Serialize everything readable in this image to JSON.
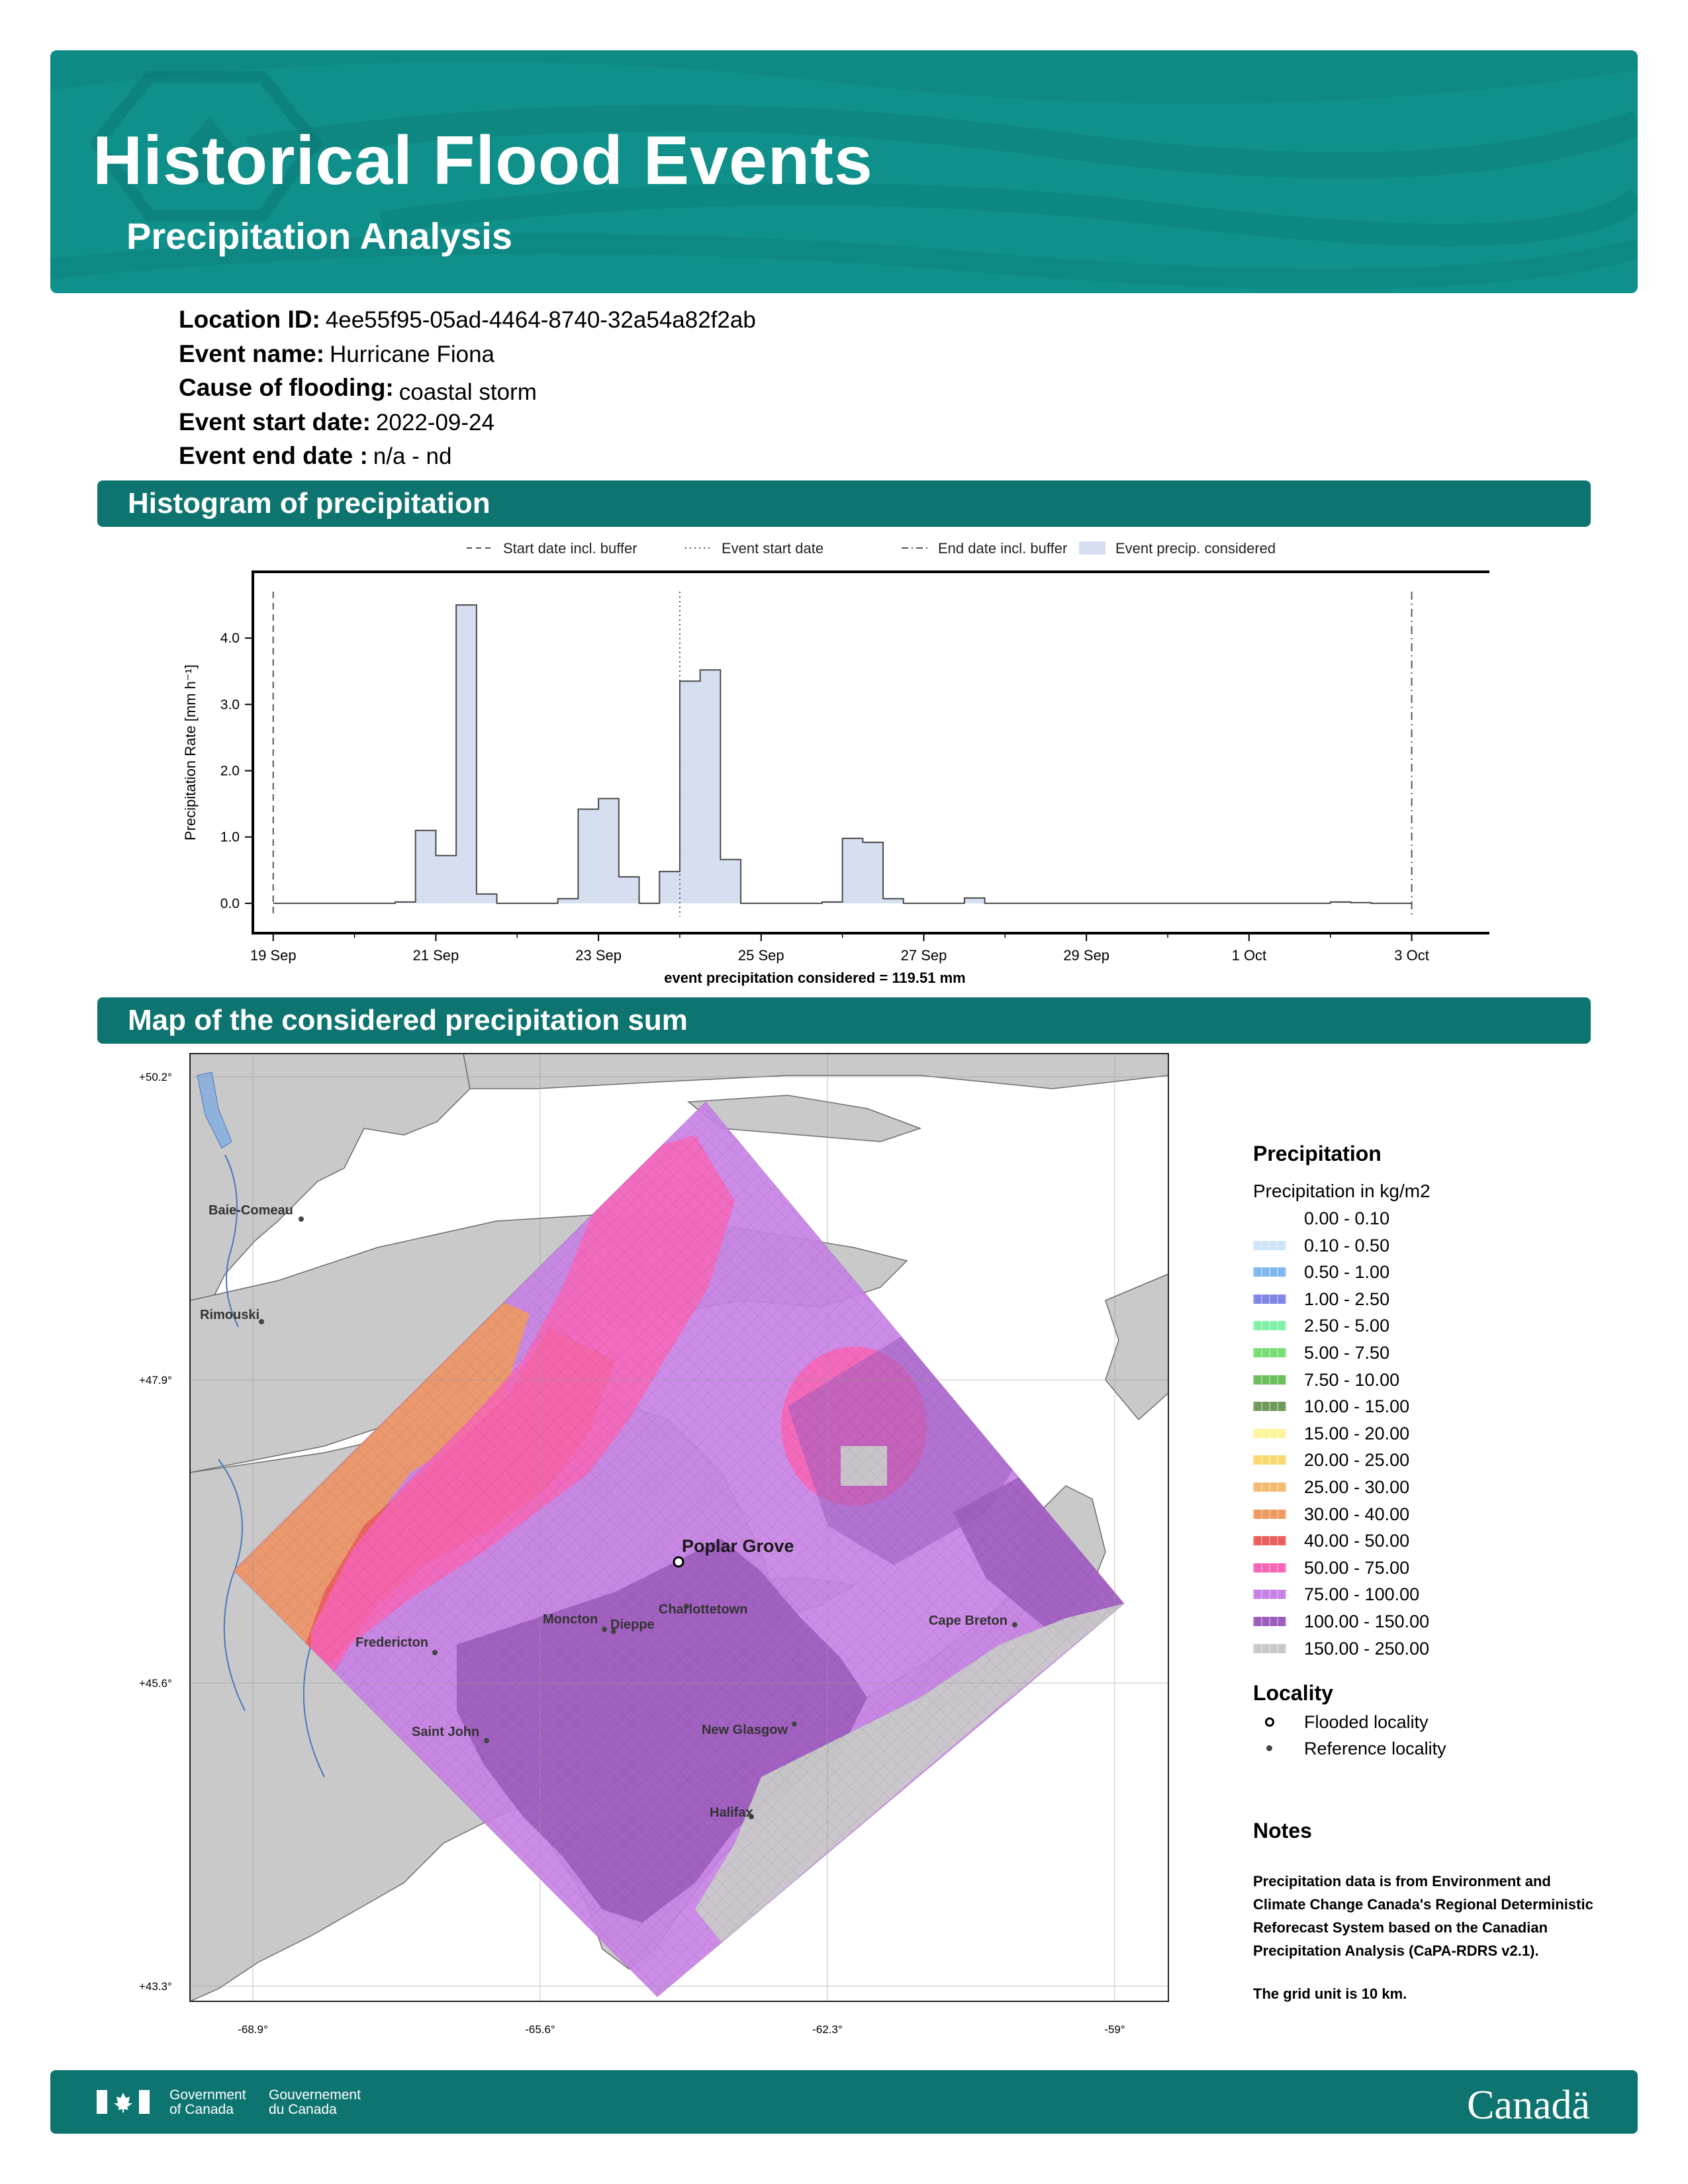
{
  "header": {
    "title": "Historical Flood Events",
    "subtitle": "Precipitation Analysis"
  },
  "info": {
    "location_id_label": "Location ID:",
    "location_id": "4ee55f95-05ad-4464-8740-32a54a82f2ab",
    "event_name_label": "Event name:",
    "event_name": "Hurricane Fiona",
    "cause_label": "Cause of flooding:",
    "cause": "coastal storm",
    "start_label": "Event start date:",
    "start": "2022-09-24",
    "end_label": "Event end date :",
    "end": "n/a - nd"
  },
  "sections": {
    "histogram": "Histogram of precipitation",
    "map": "Map of the considered precipitation sum"
  },
  "chart_data": {
    "type": "bar",
    "ylabel": "Precipitation Rate [mm h⁻¹]",
    "xlabel": "event precipitation considered = 119.51 mm",
    "ylim": [
      -0.45,
      5.0
    ],
    "yticks": [
      "0.0",
      "1.0",
      "2.0",
      "3.0",
      "4.0"
    ],
    "xlim_days": [
      18.75,
      34.2
    ],
    "xticks": [
      {
        "label": "19 Sep",
        "day": 19
      },
      {
        "label": "21 Sep",
        "day": 21
      },
      {
        "label": "23 Sep",
        "day": 23
      },
      {
        "label": "25 Sep",
        "day": 25
      },
      {
        "label": "27 Sep",
        "day": 27
      },
      {
        "label": "29 Sep",
        "day": 29
      },
      {
        "label": "1 Oct",
        "day": 31
      },
      {
        "label": "3 Oct",
        "day": 33
      }
    ],
    "bar_width_days": 0.25,
    "bars": [
      {
        "day": 19.0,
        "value": 0.0
      },
      {
        "day": 19.25,
        "value": 0.0
      },
      {
        "day": 19.5,
        "value": 0.0
      },
      {
        "day": 19.75,
        "value": 0.0
      },
      {
        "day": 20.0,
        "value": 0.0
      },
      {
        "day": 20.25,
        "value": 0.0
      },
      {
        "day": 20.5,
        "value": 0.02
      },
      {
        "day": 20.75,
        "value": 1.1
      },
      {
        "day": 21.0,
        "value": 0.72
      },
      {
        "day": 21.25,
        "value": 4.5
      },
      {
        "day": 21.5,
        "value": 0.14
      },
      {
        "day": 21.75,
        "value": 0.0
      },
      {
        "day": 22.0,
        "value": 0.0
      },
      {
        "day": 22.25,
        "value": 0.0
      },
      {
        "day": 22.5,
        "value": 0.07
      },
      {
        "day": 22.75,
        "value": 1.42
      },
      {
        "day": 23.0,
        "value": 1.58
      },
      {
        "day": 23.25,
        "value": 0.4
      },
      {
        "day": 23.5,
        "value": 0.0
      },
      {
        "day": 23.75,
        "value": 0.48
      },
      {
        "day": 24.0,
        "value": 3.35
      },
      {
        "day": 24.25,
        "value": 3.52
      },
      {
        "day": 24.5,
        "value": 0.66
      },
      {
        "day": 24.75,
        "value": 0.0
      },
      {
        "day": 25.0,
        "value": 0.0
      },
      {
        "day": 25.25,
        "value": 0.0
      },
      {
        "day": 25.5,
        "value": 0.0
      },
      {
        "day": 25.75,
        "value": 0.02
      },
      {
        "day": 26.0,
        "value": 0.98
      },
      {
        "day": 26.25,
        "value": 0.92
      },
      {
        "day": 26.5,
        "value": 0.07
      },
      {
        "day": 26.75,
        "value": 0.0
      },
      {
        "day": 27.0,
        "value": 0.0
      },
      {
        "day": 27.25,
        "value": 0.0
      },
      {
        "day": 27.5,
        "value": 0.08
      },
      {
        "day": 27.75,
        "value": 0.0
      },
      {
        "day": 28.0,
        "value": 0.0
      },
      {
        "day": 28.25,
        "value": 0.0
      },
      {
        "day": 28.5,
        "value": 0.0
      },
      {
        "day": 28.75,
        "value": 0.0
      },
      {
        "day": 29.0,
        "value": 0.0
      },
      {
        "day": 29.25,
        "value": 0.0
      },
      {
        "day": 29.5,
        "value": 0.0
      },
      {
        "day": 29.75,
        "value": 0.0
      },
      {
        "day": 30.0,
        "value": 0.0
      },
      {
        "day": 30.25,
        "value": 0.0
      },
      {
        "day": 30.5,
        "value": 0.0
      },
      {
        "day": 30.75,
        "value": 0.0
      },
      {
        "day": 31.0,
        "value": 0.0
      },
      {
        "day": 31.25,
        "value": 0.0
      },
      {
        "day": 31.5,
        "value": 0.0
      },
      {
        "day": 31.75,
        "value": 0.0
      },
      {
        "day": 32.0,
        "value": 0.02
      },
      {
        "day": 32.25,
        "value": 0.01
      },
      {
        "day": 32.5,
        "value": 0.0
      },
      {
        "day": 32.75,
        "value": 0.0
      }
    ],
    "vlines": [
      {
        "day": 19,
        "style": "dashed",
        "legend": "Start date incl. buffer"
      },
      {
        "day": 24,
        "style": "dotted",
        "legend": "Event start date"
      },
      {
        "day": 33,
        "style": "dashdot",
        "legend": "End date incl. buffer"
      }
    ],
    "fill_legend": "Event precip. considered",
    "bar_color": "#d5dff0",
    "bar_edge": "#4a4a4a"
  },
  "map": {
    "lat_labels": [
      "+50.2°",
      "+47.9°",
      "+45.6°",
      "+43.3°"
    ],
    "lon_labels": [
      "-68.9°",
      "-65.6°",
      "-62.3°",
      "-59°"
    ],
    "flooded_locality": "Poplar Grove",
    "reference_localities": [
      "Baie-Comeau",
      "Rimouski",
      "Fredericton",
      "Moncton",
      "Dieppe",
      "Charlottetown",
      "Saint John",
      "New Glasgow",
      "Halifax",
      "Cape Breton"
    ]
  },
  "legend": {
    "title": "Precipitation",
    "subtitle": "Precipitation in kg/m2",
    "classes": [
      {
        "label": "0.00 - 0.10",
        "color": "#ffffff"
      },
      {
        "label": "0.10 - 0.50",
        "color": "#cfe5f7"
      },
      {
        "label": "0.50 - 1.00",
        "color": "#7fb8ee"
      },
      {
        "label": "1.00 - 2.50",
        "color": "#7f86e6"
      },
      {
        "label": "2.50 - 5.00",
        "color": "#7ff0a6"
      },
      {
        "label": "5.00 - 7.50",
        "color": "#78dd72"
      },
      {
        "label": "7.50 - 10.00",
        "color": "#6cbd5c"
      },
      {
        "label": "10.00 - 15.00",
        "color": "#6f9a5d"
      },
      {
        "label": "15.00 - 20.00",
        "color": "#fdf59b"
      },
      {
        "label": "20.00 - 25.00",
        "color": "#f7d86f"
      },
      {
        "label": "25.00 - 30.00",
        "color": "#f2bb6f"
      },
      {
        "label": "30.00 - 40.00",
        "color": "#ee9a60"
      },
      {
        "label": "40.00 - 50.00",
        "color": "#ea5e5c"
      },
      {
        "label": "50.00 - 75.00",
        "color": "#f765b6"
      },
      {
        "label": "75.00 - 100.00",
        "color": "#c680e6"
      },
      {
        "label": "100.00 - 150.00",
        "color": "#9d5dbd"
      },
      {
        "label": "150.00 - 250.00",
        "color": "#c9c9c9"
      }
    ],
    "locality_title": "Locality",
    "flooded_label": "Flooded locality",
    "reference_label": "Reference locality"
  },
  "notes": {
    "title": "Notes",
    "body": "Precipitation data is from Environment and Climate Change Canada's Regional Deterministic Reforecast System based on the Canadian Precipitation Analysis (CaPA-RDRS v2.1).",
    "grid": "The grid unit is 10 km."
  },
  "footer": {
    "gov_en": "Government\nof Canada",
    "gov_fr": "Gouvernement\ndu Canada",
    "wordmark": "Canadä"
  }
}
